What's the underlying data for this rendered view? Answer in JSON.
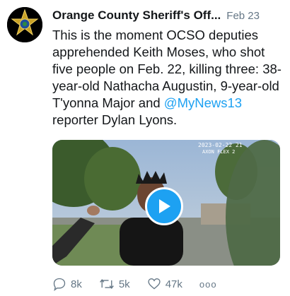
{
  "tweet": {
    "author_name": "Orange County Sheriff's Off...",
    "date": "Feb 23",
    "text_before": "This is the moment OCSO deputies apprehended Keith Moses, who shot five people on Feb. 22, killing three: 38-year-old Nathacha Augustin, 9-year-old T'yonna Major and ",
    "mention": "@MyNews13",
    "text_after": " reporter Dylan Lyons.",
    "video_timestamp": "2023-02-22 21",
    "video_caption": "AXON FLEX 2",
    "actions": {
      "replies": "8k",
      "retweets": "5k",
      "likes": "47k",
      "more": "ooo"
    }
  },
  "colors": {
    "accent": "#1da1f2",
    "muted": "#657786",
    "text": "#14171a",
    "badge_gold": "#c9a227"
  },
  "icons": [
    "sheriff-star-icon",
    "play-icon",
    "reply-icon",
    "retweet-icon",
    "like-icon",
    "more-icon"
  ]
}
